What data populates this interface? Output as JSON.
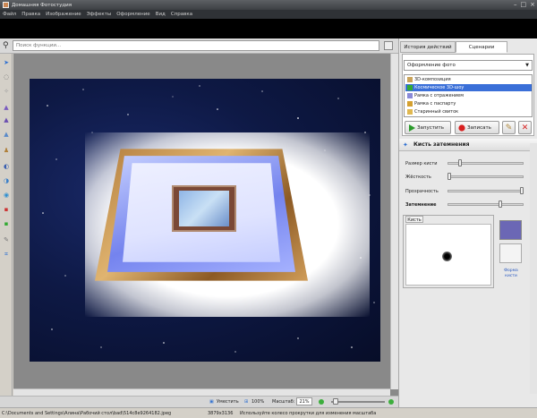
{
  "window": {
    "title": "Домашняя Фотостудия",
    "buttons": [
      "–",
      "□",
      "×"
    ]
  },
  "menu": [
    "Файл",
    "Правка",
    "Изображение",
    "Эффекты",
    "Оформление",
    "Вид",
    "Справка"
  ],
  "search": {
    "placeholder": "Поиск функции..."
  },
  "tabs": {
    "history": "История действий",
    "scripts": "Сценарии"
  },
  "scripts": {
    "selected_category": "Оформление фото",
    "items": [
      {
        "label": "3D-композиция",
        "selected": false
      },
      {
        "label": "Космическое 3D-шоу",
        "selected": true
      },
      {
        "label": "Рамка с отражением",
        "selected": false
      },
      {
        "label": "Рамка с паспарту",
        "selected": false
      },
      {
        "label": "Старинный свиток",
        "selected": false
      }
    ],
    "run_label": "Запустить",
    "record_label": "Записать"
  },
  "brush": {
    "title": "Кисть затемнения",
    "sliders": [
      {
        "label": "Размер кисти",
        "value": 0.15
      },
      {
        "label": "Жёсткость",
        "value": 0.0
      },
      {
        "label": "Прозрачность",
        "value": 1.0
      },
      {
        "label": "Затемнение",
        "value": 0.7
      }
    ],
    "tab_label": "Кисть",
    "shape_label": "Форма кисти",
    "color": "#6b67b5"
  },
  "zoom": {
    "fit_label": "Уместить",
    "percent_label": "100%",
    "scale_label": "Масштаб:",
    "value": "21%"
  },
  "status": {
    "path": "C:\\Documents and Settings\\Алина\\Рабочий стол\\bad\\514c8e9264182.jpeg",
    "dimensions": "3879x3136",
    "hint": "Используйте колесо прокрутки для изменения масштаба"
  }
}
